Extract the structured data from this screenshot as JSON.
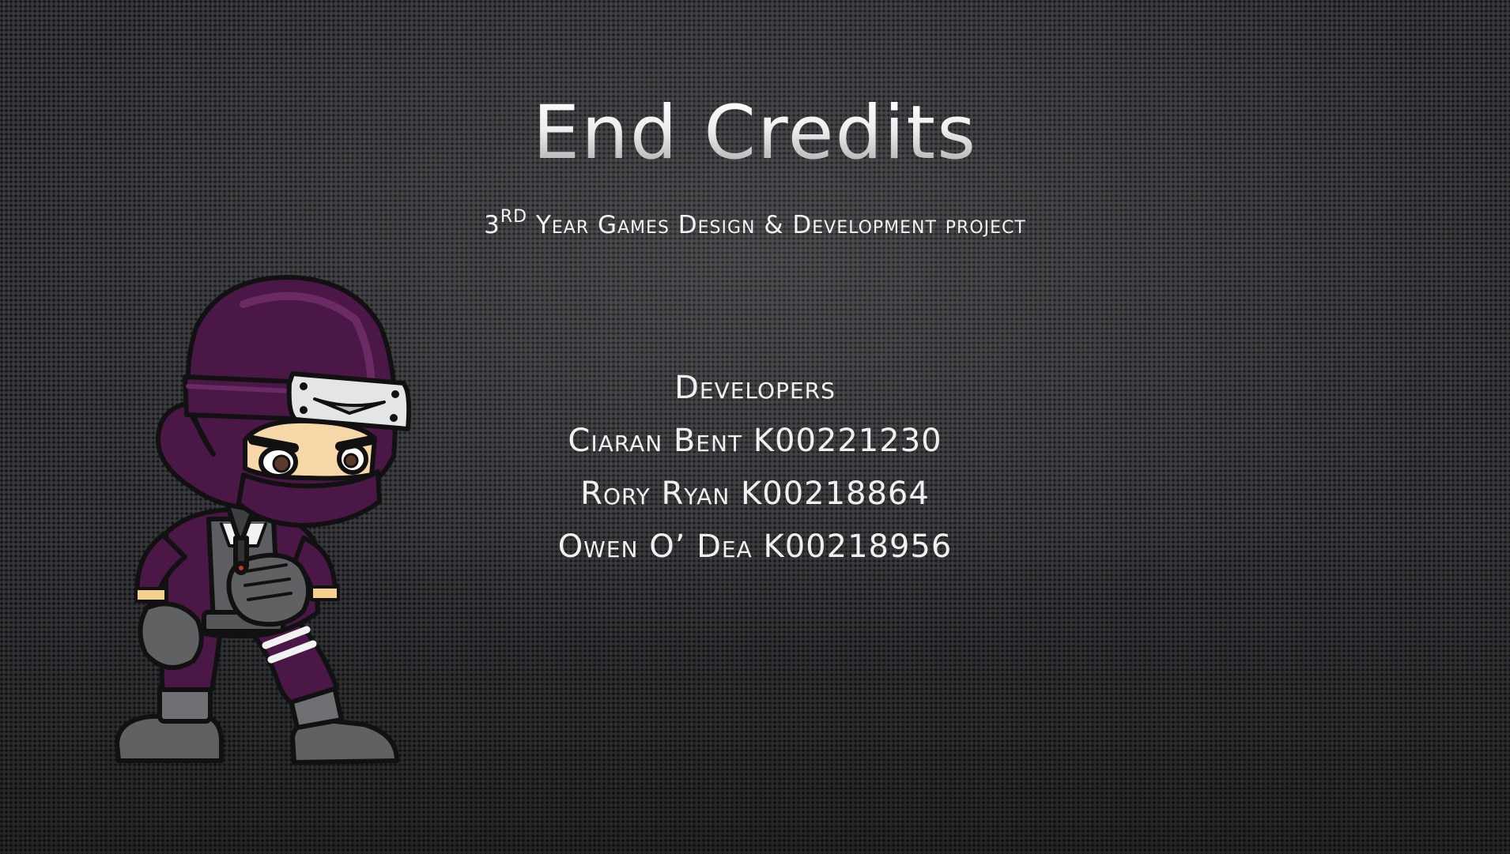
{
  "slide": {
    "title": "End Credits",
    "subtitle": {
      "ordinal_number": "3",
      "ordinal_suffix": "RD",
      "text": " Year Games Design & Development project"
    },
    "credits": {
      "heading": "Developers",
      "developers": [
        {
          "text": "Ciaran Bent K00221230"
        },
        {
          "text": "Rory Ryan K00218864"
        },
        {
          "text": "Owen O’ Dea K00218956"
        }
      ]
    }
  },
  "colors": {
    "background": "#2c2d30",
    "text": "#f0f0f0",
    "ninja_purple": "#4b1746",
    "ninja_gray": "#5f6163"
  },
  "icons": {
    "character": "ninja-character-icon"
  }
}
